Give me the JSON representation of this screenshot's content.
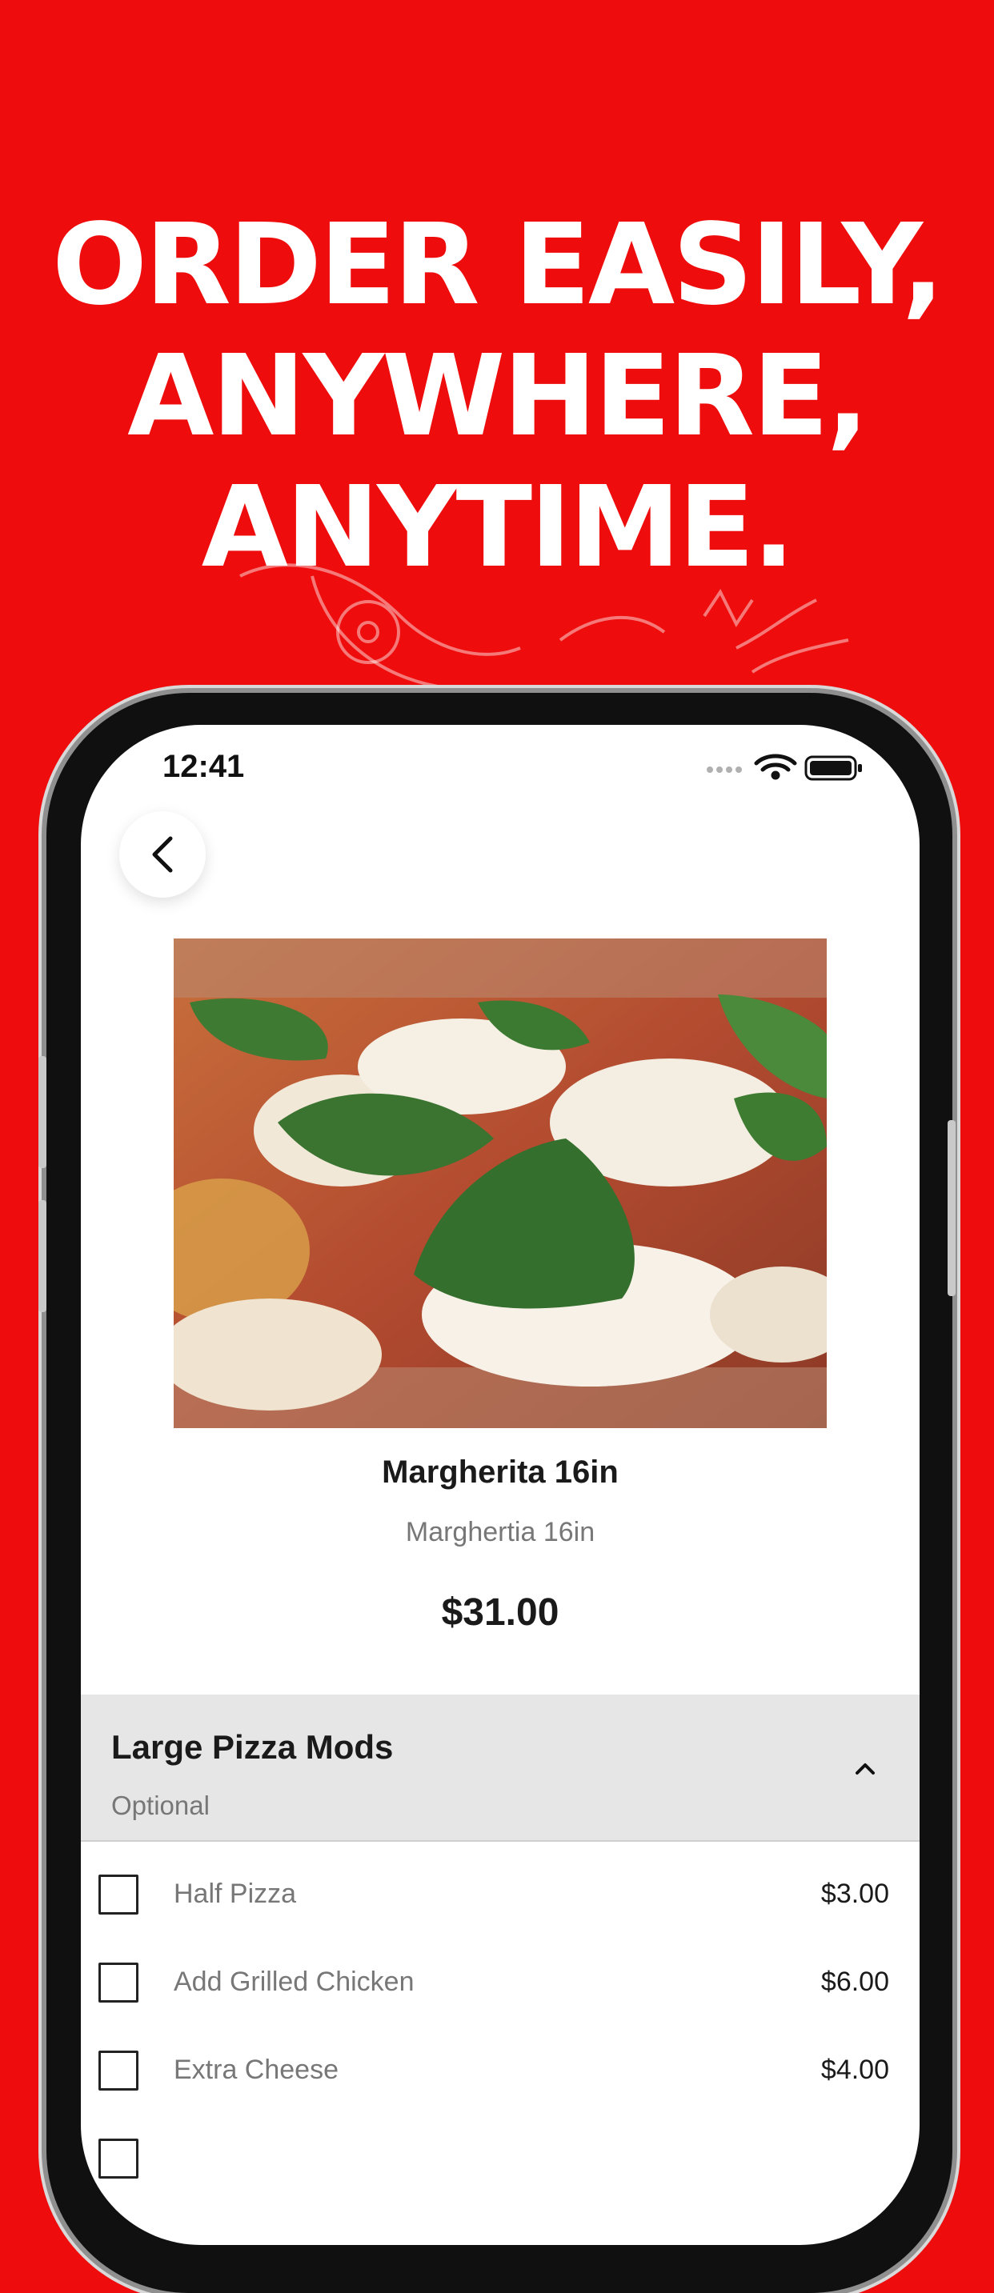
{
  "headline": {
    "line1": "ORDER EASILY,",
    "line2": "ANYWHERE,",
    "line3": "ANYTIME."
  },
  "colors": {
    "background": "#ee0c0c",
    "headline_text": "#ffffff",
    "section_header": "#e6e6e6"
  },
  "status_bar": {
    "time": "12:41"
  },
  "product": {
    "name": "Margherita 16in",
    "description": "Marghertia 16in",
    "price": "$31.00"
  },
  "modifiers": {
    "title": "Large Pizza Mods",
    "subtitle": "Optional",
    "options": [
      {
        "label": "Half Pizza",
        "price": "$3.00"
      },
      {
        "label": "Add Grilled Chicken",
        "price": "$6.00"
      },
      {
        "label": "Extra Cheese",
        "price": "$4.00"
      }
    ]
  }
}
